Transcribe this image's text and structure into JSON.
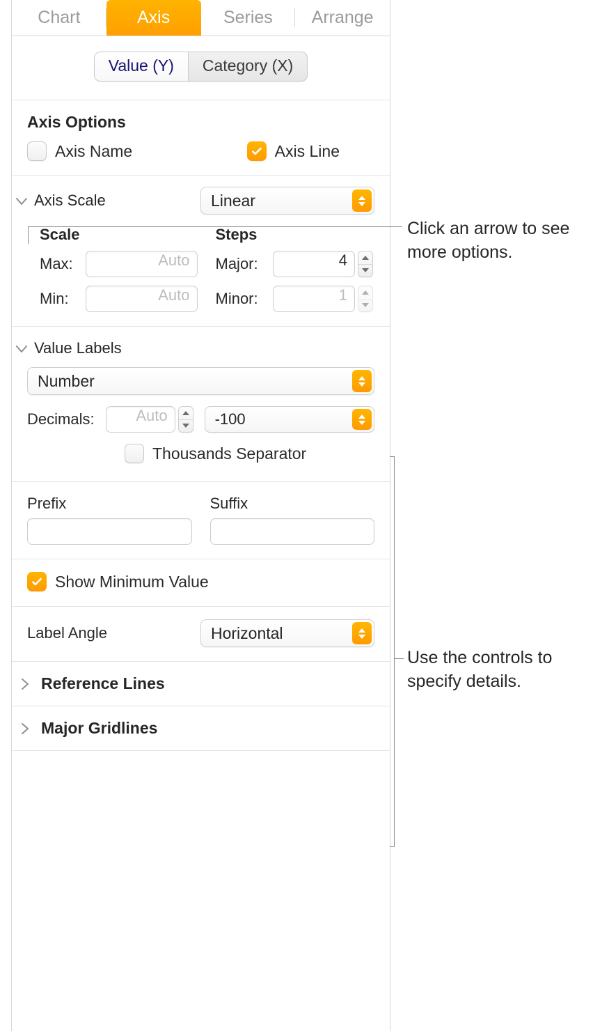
{
  "tabs": {
    "chart": "Chart",
    "axis": "Axis",
    "series": "Series",
    "arrange": "Arrange"
  },
  "segmented": {
    "value_y": "Value (Y)",
    "category_x": "Category (X)"
  },
  "axis_options": {
    "heading": "Axis Options",
    "axis_name": "Axis Name",
    "axis_line": "Axis Line"
  },
  "axis_scale": {
    "title": "Axis Scale",
    "popup": "Linear",
    "scale_heading": "Scale",
    "steps_heading": "Steps",
    "max_label": "Max:",
    "min_label": "Min:",
    "max_value": "Auto",
    "min_value": "Auto",
    "major_label": "Major:",
    "minor_label": "Minor:",
    "major_value": "4",
    "minor_value": "1"
  },
  "value_labels": {
    "title": "Value Labels",
    "format": "Number",
    "decimals_label": "Decimals:",
    "decimals_value": "Auto",
    "neg_format": "-100",
    "thousands": "Thousands Separator",
    "prefix_label": "Prefix",
    "suffix_label": "Suffix",
    "show_min": "Show Minimum Value",
    "angle_label": "Label Angle",
    "angle_value": "Horizontal"
  },
  "reference_lines": "Reference Lines",
  "major_gridlines": "Major Gridlines",
  "annotations": {
    "top": "Click an arrow to see more options.",
    "mid": "Use the controls to specify details."
  }
}
